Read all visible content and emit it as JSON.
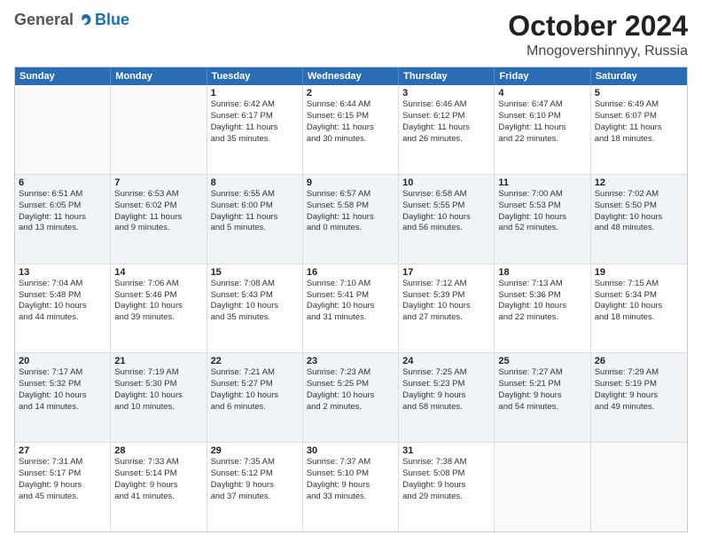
{
  "logo": {
    "general": "General",
    "blue": "Blue"
  },
  "title": "October 2024",
  "location": "Mnogovershinnyy, Russia",
  "header_days": [
    "Sunday",
    "Monday",
    "Tuesday",
    "Wednesday",
    "Thursday",
    "Friday",
    "Saturday"
  ],
  "rows": [
    [
      {
        "day": "",
        "sunrise": "",
        "sunset": "",
        "daylight1": "",
        "daylight2": "",
        "empty": true
      },
      {
        "day": "",
        "sunrise": "",
        "sunset": "",
        "daylight1": "",
        "daylight2": "",
        "empty": true
      },
      {
        "day": "1",
        "sunrise": "Sunrise: 6:42 AM",
        "sunset": "Sunset: 6:17 PM",
        "daylight1": "Daylight: 11 hours",
        "daylight2": "and 35 minutes."
      },
      {
        "day": "2",
        "sunrise": "Sunrise: 6:44 AM",
        "sunset": "Sunset: 6:15 PM",
        "daylight1": "Daylight: 11 hours",
        "daylight2": "and 30 minutes."
      },
      {
        "day": "3",
        "sunrise": "Sunrise: 6:46 AM",
        "sunset": "Sunset: 6:12 PM",
        "daylight1": "Daylight: 11 hours",
        "daylight2": "and 26 minutes."
      },
      {
        "day": "4",
        "sunrise": "Sunrise: 6:47 AM",
        "sunset": "Sunset: 6:10 PM",
        "daylight1": "Daylight: 11 hours",
        "daylight2": "and 22 minutes."
      },
      {
        "day": "5",
        "sunrise": "Sunrise: 6:49 AM",
        "sunset": "Sunset: 6:07 PM",
        "daylight1": "Daylight: 11 hours",
        "daylight2": "and 18 minutes."
      }
    ],
    [
      {
        "day": "6",
        "sunrise": "Sunrise: 6:51 AM",
        "sunset": "Sunset: 6:05 PM",
        "daylight1": "Daylight: 11 hours",
        "daylight2": "and 13 minutes."
      },
      {
        "day": "7",
        "sunrise": "Sunrise: 6:53 AM",
        "sunset": "Sunset: 6:02 PM",
        "daylight1": "Daylight: 11 hours",
        "daylight2": "and 9 minutes."
      },
      {
        "day": "8",
        "sunrise": "Sunrise: 6:55 AM",
        "sunset": "Sunset: 6:00 PM",
        "daylight1": "Daylight: 11 hours",
        "daylight2": "and 5 minutes."
      },
      {
        "day": "9",
        "sunrise": "Sunrise: 6:57 AM",
        "sunset": "Sunset: 5:58 PM",
        "daylight1": "Daylight: 11 hours",
        "daylight2": "and 0 minutes."
      },
      {
        "day": "10",
        "sunrise": "Sunrise: 6:58 AM",
        "sunset": "Sunset: 5:55 PM",
        "daylight1": "Daylight: 10 hours",
        "daylight2": "and 56 minutes."
      },
      {
        "day": "11",
        "sunrise": "Sunrise: 7:00 AM",
        "sunset": "Sunset: 5:53 PM",
        "daylight1": "Daylight: 10 hours",
        "daylight2": "and 52 minutes."
      },
      {
        "day": "12",
        "sunrise": "Sunrise: 7:02 AM",
        "sunset": "Sunset: 5:50 PM",
        "daylight1": "Daylight: 10 hours",
        "daylight2": "and 48 minutes."
      }
    ],
    [
      {
        "day": "13",
        "sunrise": "Sunrise: 7:04 AM",
        "sunset": "Sunset: 5:48 PM",
        "daylight1": "Daylight: 10 hours",
        "daylight2": "and 44 minutes."
      },
      {
        "day": "14",
        "sunrise": "Sunrise: 7:06 AM",
        "sunset": "Sunset: 5:46 PM",
        "daylight1": "Daylight: 10 hours",
        "daylight2": "and 39 minutes."
      },
      {
        "day": "15",
        "sunrise": "Sunrise: 7:08 AM",
        "sunset": "Sunset: 5:43 PM",
        "daylight1": "Daylight: 10 hours",
        "daylight2": "and 35 minutes."
      },
      {
        "day": "16",
        "sunrise": "Sunrise: 7:10 AM",
        "sunset": "Sunset: 5:41 PM",
        "daylight1": "Daylight: 10 hours",
        "daylight2": "and 31 minutes."
      },
      {
        "day": "17",
        "sunrise": "Sunrise: 7:12 AM",
        "sunset": "Sunset: 5:39 PM",
        "daylight1": "Daylight: 10 hours",
        "daylight2": "and 27 minutes."
      },
      {
        "day": "18",
        "sunrise": "Sunrise: 7:13 AM",
        "sunset": "Sunset: 5:36 PM",
        "daylight1": "Daylight: 10 hours",
        "daylight2": "and 22 minutes."
      },
      {
        "day": "19",
        "sunrise": "Sunrise: 7:15 AM",
        "sunset": "Sunset: 5:34 PM",
        "daylight1": "Daylight: 10 hours",
        "daylight2": "and 18 minutes."
      }
    ],
    [
      {
        "day": "20",
        "sunrise": "Sunrise: 7:17 AM",
        "sunset": "Sunset: 5:32 PM",
        "daylight1": "Daylight: 10 hours",
        "daylight2": "and 14 minutes."
      },
      {
        "day": "21",
        "sunrise": "Sunrise: 7:19 AM",
        "sunset": "Sunset: 5:30 PM",
        "daylight1": "Daylight: 10 hours",
        "daylight2": "and 10 minutes."
      },
      {
        "day": "22",
        "sunrise": "Sunrise: 7:21 AM",
        "sunset": "Sunset: 5:27 PM",
        "daylight1": "Daylight: 10 hours",
        "daylight2": "and 6 minutes."
      },
      {
        "day": "23",
        "sunrise": "Sunrise: 7:23 AM",
        "sunset": "Sunset: 5:25 PM",
        "daylight1": "Daylight: 10 hours",
        "daylight2": "and 2 minutes."
      },
      {
        "day": "24",
        "sunrise": "Sunrise: 7:25 AM",
        "sunset": "Sunset: 5:23 PM",
        "daylight1": "Daylight: 9 hours",
        "daylight2": "and 58 minutes."
      },
      {
        "day": "25",
        "sunrise": "Sunrise: 7:27 AM",
        "sunset": "Sunset: 5:21 PM",
        "daylight1": "Daylight: 9 hours",
        "daylight2": "and 54 minutes."
      },
      {
        "day": "26",
        "sunrise": "Sunrise: 7:29 AM",
        "sunset": "Sunset: 5:19 PM",
        "daylight1": "Daylight: 9 hours",
        "daylight2": "and 49 minutes."
      }
    ],
    [
      {
        "day": "27",
        "sunrise": "Sunrise: 7:31 AM",
        "sunset": "Sunset: 5:17 PM",
        "daylight1": "Daylight: 9 hours",
        "daylight2": "and 45 minutes."
      },
      {
        "day": "28",
        "sunrise": "Sunrise: 7:33 AM",
        "sunset": "Sunset: 5:14 PM",
        "daylight1": "Daylight: 9 hours",
        "daylight2": "and 41 minutes."
      },
      {
        "day": "29",
        "sunrise": "Sunrise: 7:35 AM",
        "sunset": "Sunset: 5:12 PM",
        "daylight1": "Daylight: 9 hours",
        "daylight2": "and 37 minutes."
      },
      {
        "day": "30",
        "sunrise": "Sunrise: 7:37 AM",
        "sunset": "Sunset: 5:10 PM",
        "daylight1": "Daylight: 9 hours",
        "daylight2": "and 33 minutes."
      },
      {
        "day": "31",
        "sunrise": "Sunrise: 7:38 AM",
        "sunset": "Sunset: 5:08 PM",
        "daylight1": "Daylight: 9 hours",
        "daylight2": "and 29 minutes."
      },
      {
        "day": "",
        "sunrise": "",
        "sunset": "",
        "daylight1": "",
        "daylight2": "",
        "empty": true
      },
      {
        "day": "",
        "sunrise": "",
        "sunset": "",
        "daylight1": "",
        "daylight2": "",
        "empty": true
      }
    ]
  ]
}
